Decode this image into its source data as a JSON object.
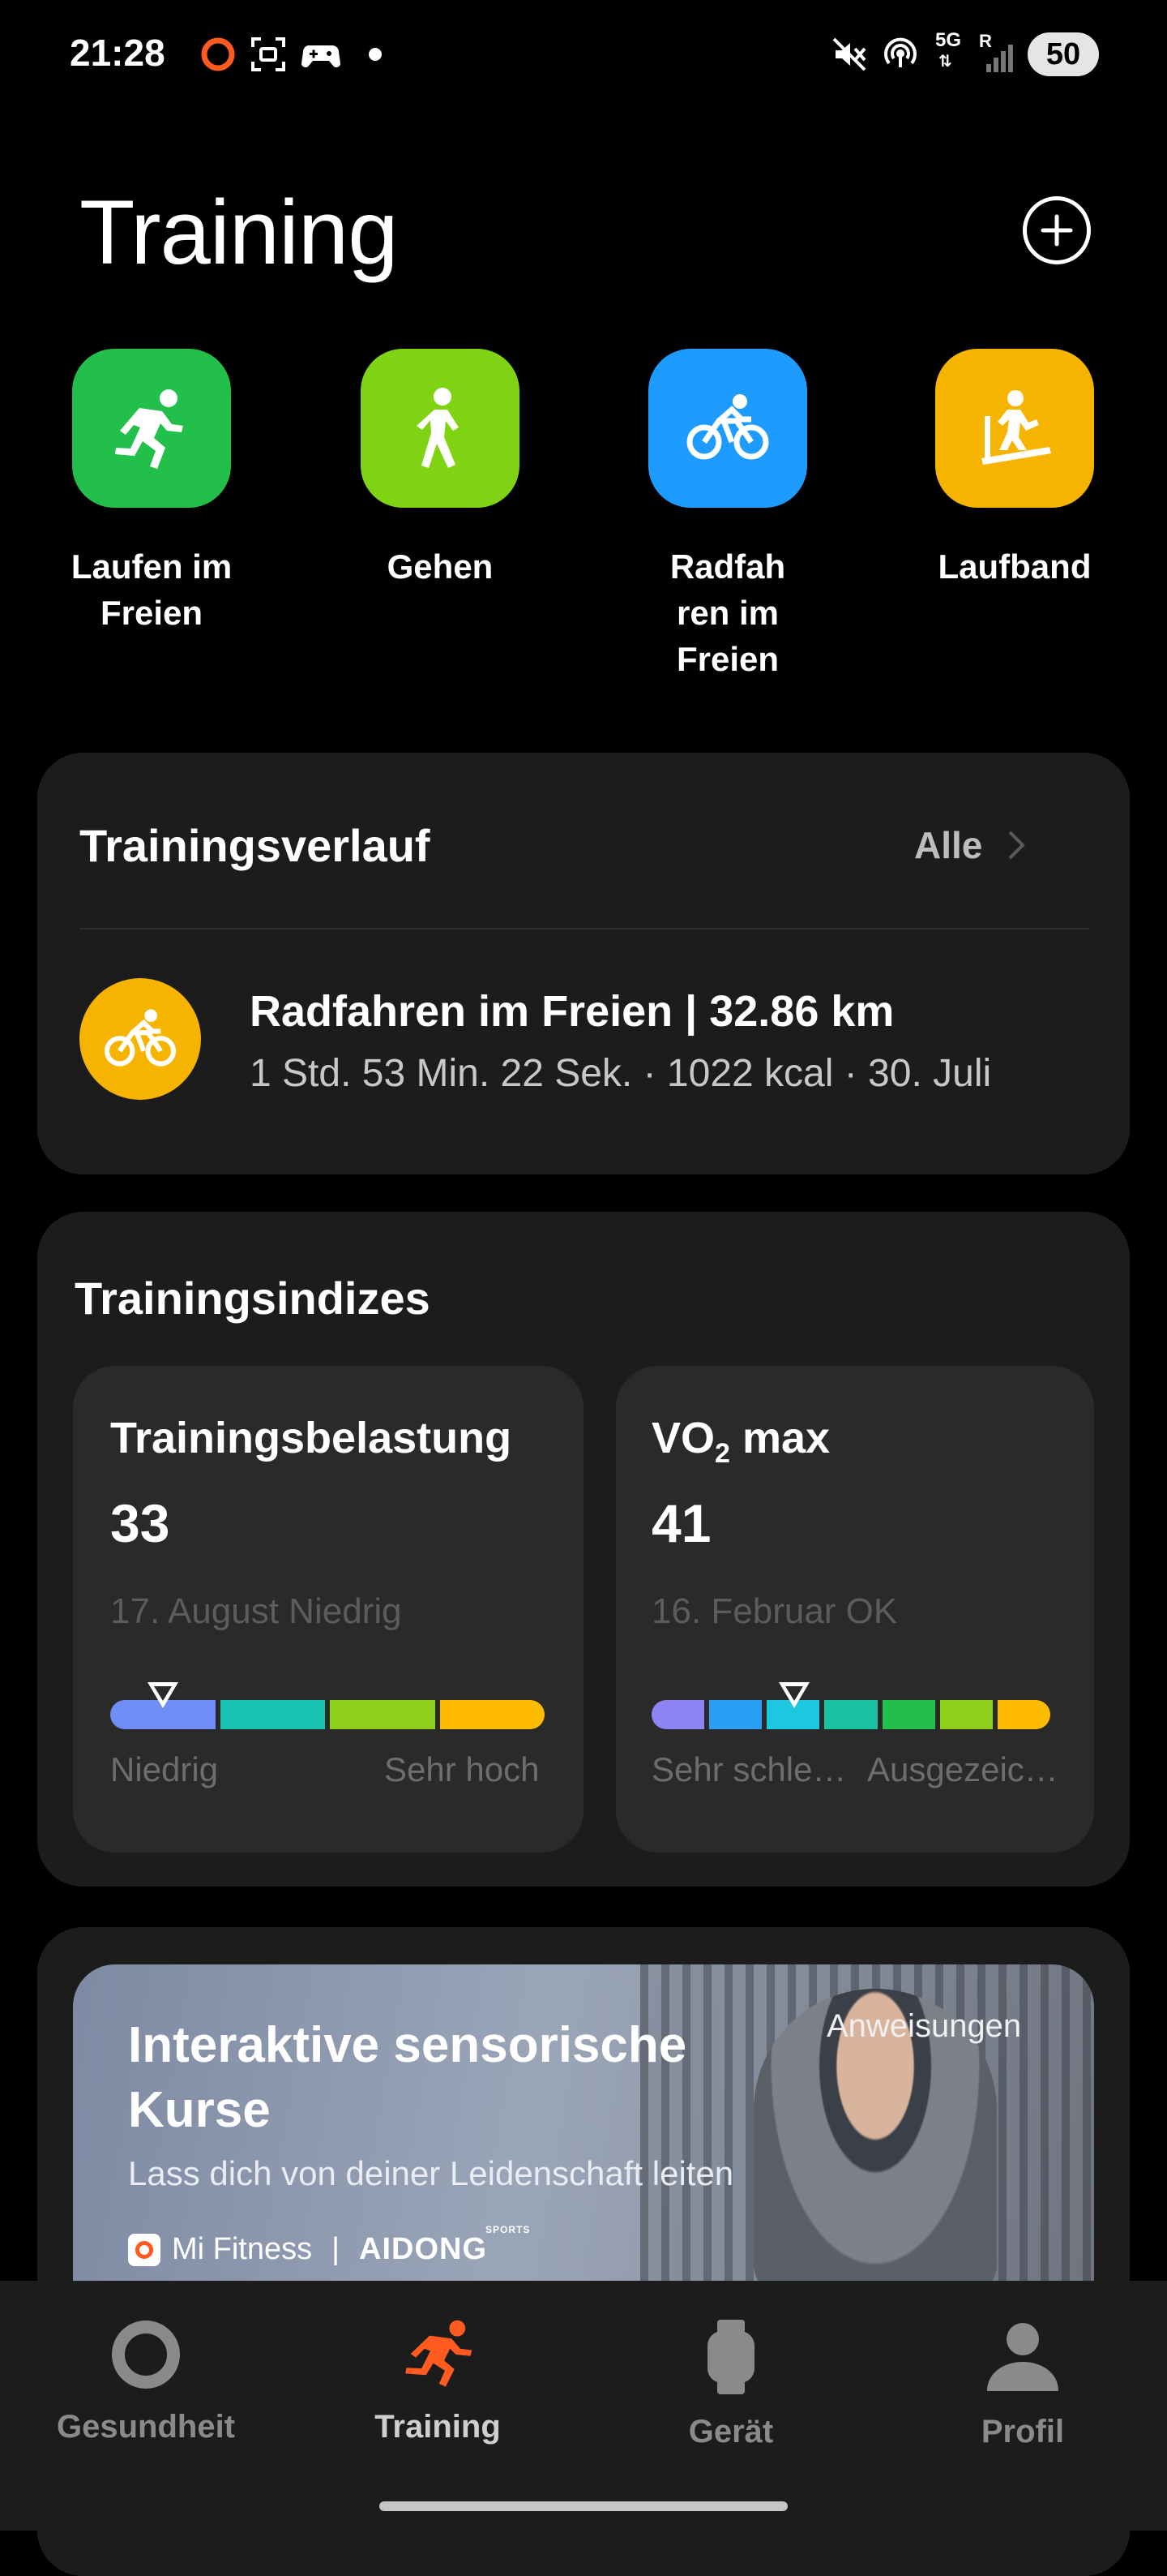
{
  "status_bar": {
    "time": "21:28",
    "network": "5G",
    "roaming": "R",
    "battery": "50",
    "icons": [
      "recording-icon",
      "screenshot-icon",
      "game-controller-icon",
      "dot-icon",
      "mute-icon",
      "hotspot-icon",
      "signal-icon"
    ]
  },
  "header": {
    "title": "Training",
    "add_icon": "plus-circle-icon"
  },
  "quick_activities": [
    {
      "label": "Laufen im Freien",
      "color": "#22c04a",
      "icon": "running-icon"
    },
    {
      "label": "Gehen",
      "color": "#7fd312",
      "icon": "walking-icon"
    },
    {
      "label": "Radfah ren im Freien",
      "color": "#1e9bff",
      "icon": "cycling-icon"
    },
    {
      "label": "Laufband",
      "color": "#f6b400",
      "icon": "treadmill-icon"
    }
  ],
  "history": {
    "title": "Trainingsverlauf",
    "all_label": "Alle",
    "item": {
      "icon": "cycling-icon",
      "main": "Radfahren im Freien | 32.86 km",
      "sub": "1 Std. 53 Min. 22 Sek. · 1022 kcal · 30. Juli"
    }
  },
  "indices": {
    "title": "Trainingsindizes",
    "load": {
      "title": "Trainingsbelastung",
      "value": "33",
      "date": "17. August Niedrig",
      "range_low": "Niedrig",
      "range_high": "Sehr hoch",
      "segments": [
        "#6f8df5",
        "#19c2b2",
        "#8fd01a",
        "#ffbb00"
      ],
      "marker_fraction": 0.12
    },
    "vo2": {
      "title_main": "VO",
      "title_sub": "2",
      "title_rest": " max",
      "value": "41",
      "date": "16. Februar OK",
      "range_low": "Sehr schle…",
      "range_high": "Ausgezeic…",
      "segments": [
        "#8e83f2",
        "#2a9df4",
        "#1cc7df",
        "#19c2a0",
        "#22c04a",
        "#8fd01a",
        "#ffbb00"
      ],
      "marker_fraction": 0.36
    }
  },
  "banner": {
    "title_line1": "Interaktive sensorische",
    "title_line2": "Kurse",
    "subtitle": "Lass dich von deiner Leidenschaft leiten",
    "tag": "Anweisungen",
    "brand": "Mi Fitness",
    "separator": "|",
    "partner": "AIDONG",
    "partner_small": "SPORTS"
  },
  "bottom_nav": [
    {
      "label": "Gesundheit",
      "icon": "ring-icon",
      "active": false
    },
    {
      "label": "Training",
      "icon": "running-icon",
      "active": true
    },
    {
      "label": "Gerät",
      "icon": "watch-icon",
      "active": false
    },
    {
      "label": "Profil",
      "icon": "person-icon",
      "active": false
    }
  ]
}
